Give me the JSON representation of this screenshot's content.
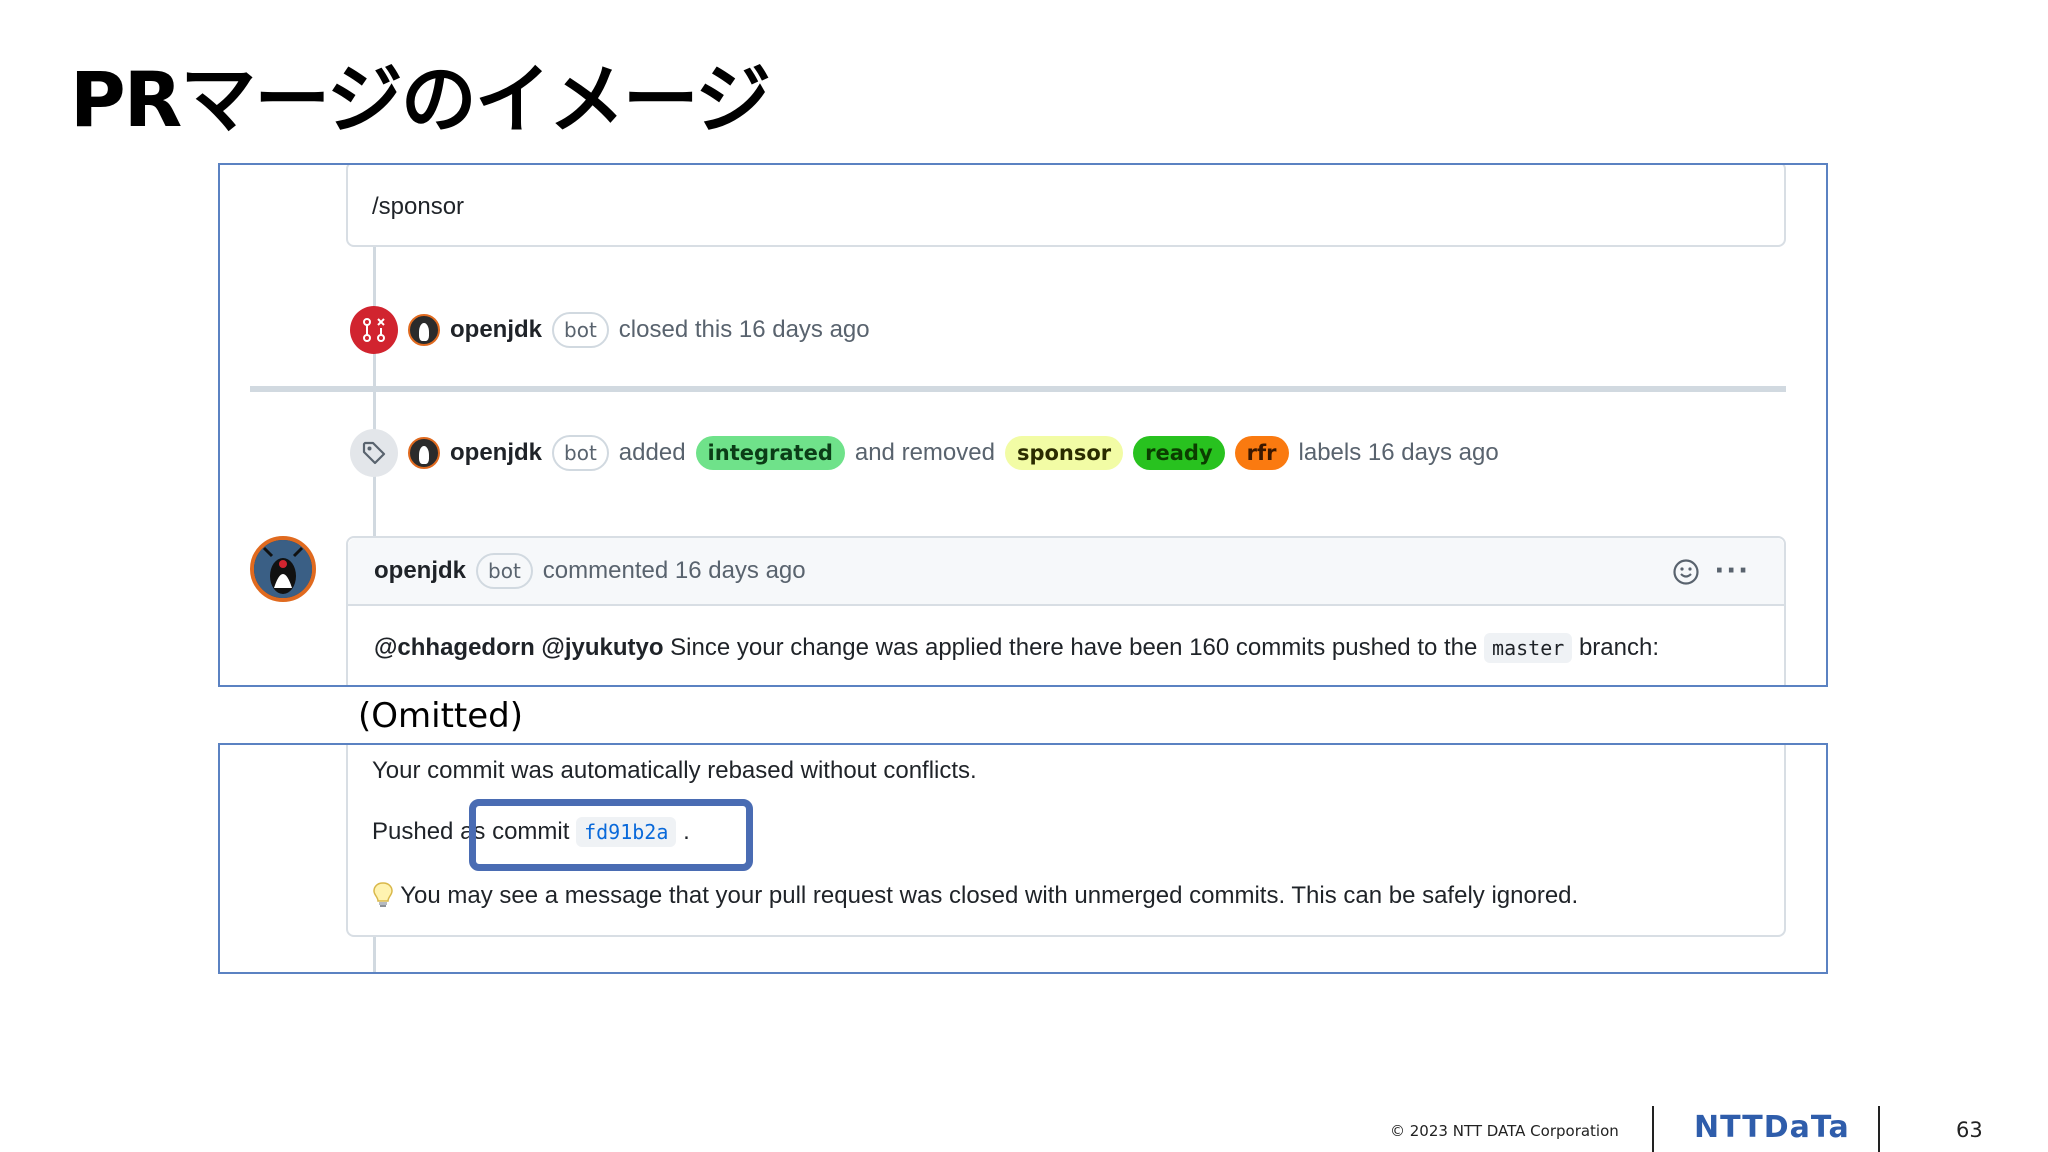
{
  "slide": {
    "title": "PRマージのイメージ",
    "omitted": "(Omitted)",
    "footer": {
      "copyright": "© 2023 NTT DATA Corporation",
      "logo": "NTTDaTa",
      "page_number": "63"
    }
  },
  "timeline": {
    "sponsor_comment": "/sponsor",
    "closed_event": {
      "user": "openjdk",
      "badge": "bot",
      "action": "closed this 16 days ago"
    },
    "label_event": {
      "user": "openjdk",
      "badge": "bot",
      "added_text": "added",
      "added_labels": [
        {
          "name": "integrated",
          "bg": "#6fe28a",
          "fg": "#0b3d17"
        }
      ],
      "removed_text": "and removed",
      "removed_labels": [
        {
          "name": "sponsor",
          "bg": "#f2fca5",
          "fg": "#2b2b00"
        },
        {
          "name": "ready",
          "bg": "#28c21f",
          "fg": "#0b3d00"
        },
        {
          "name": "rfr",
          "bg": "#fa7a10",
          "fg": "#3a1700"
        }
      ],
      "suffix": "labels 16 days ago"
    },
    "comment": {
      "user": "openjdk",
      "badge": "bot",
      "meta": "commented 16 days ago",
      "mentions": "@chhagedorn @jyukutyo",
      "body_before": "Since your change was applied there have been 160 commits pushed to the",
      "branch": "master",
      "body_after": "branch:"
    },
    "comment_tail": {
      "rebased": "Your commit was automatically rebased without conflicts.",
      "pushed_prefix": "Pushed as commit",
      "commit": "fd91b2a",
      "pushed_suffix": ".",
      "tip": "You may see a message that your pull request was closed with unmerged commits. This can be safely ignored."
    }
  },
  "colors": {
    "frame_border": "#5b82c2",
    "highlight": "#4a6cb3",
    "closed_red": "#d1242f",
    "link_blue": "#0969da"
  }
}
